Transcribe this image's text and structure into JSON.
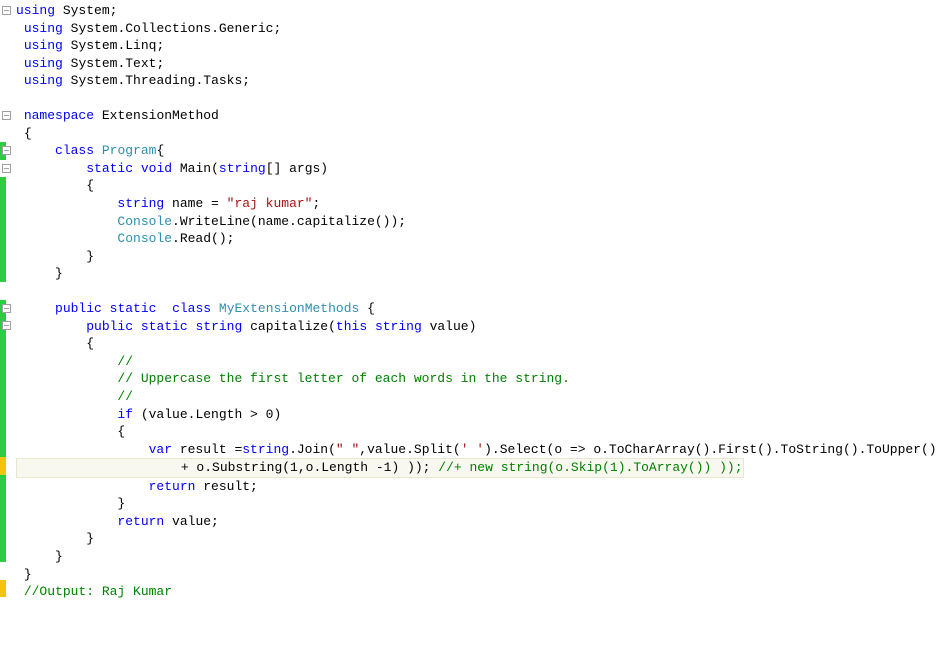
{
  "code": {
    "using": "using",
    "ns_system": "System;",
    "ns_collgen": "System.Collections.Generic;",
    "ns_linq": "System.Linq;",
    "ns_text": "System.Text;",
    "ns_tasks": "System.Threading.Tasks;",
    "namespace": "namespace",
    "ns_name": "ExtensionMethod",
    "lbrace": "{",
    "rbrace": "}",
    "class": "class",
    "public": "public",
    "static": "static",
    "void": "void",
    "string": "string",
    "this": "this",
    "var": "var",
    "if": "if",
    "return": "return",
    "program": "Program",
    "main_sig": "Main(",
    "args": "[] args)",
    "name_decl": " name = ",
    "name_val": "\"raj kumar\"",
    "semi": ";",
    "console": "Console",
    "writeline": ".WriteLine(name.capitalize());",
    "read": ".Read();",
    "myext": "MyExtensionMethods",
    "cap_name": "capitalize(",
    "value_param": " value)",
    "cmt_slash": "//",
    "cmt_desc": "// Uppercase the first letter of each words in the string.",
    "if_cond": " (value.Length > 0)",
    "result_a": " result =",
    "join_a": ".Join(",
    "space_str": "\" \"",
    "split_a": ",value.Split(",
    "split_char": "' '",
    "select_a": ").Select(o => o.ToCharArray().First().ToString().ToUpper()",
    "result_b": "+ o.Substring(1,o.Length -1) )); ",
    "cmt_inline": "//+ new string(o.Skip(1).ToArray()) ));",
    "ret_result": " result;",
    "ret_value": " value;",
    "cmt_output": "//Output: Raj Kumar"
  }
}
